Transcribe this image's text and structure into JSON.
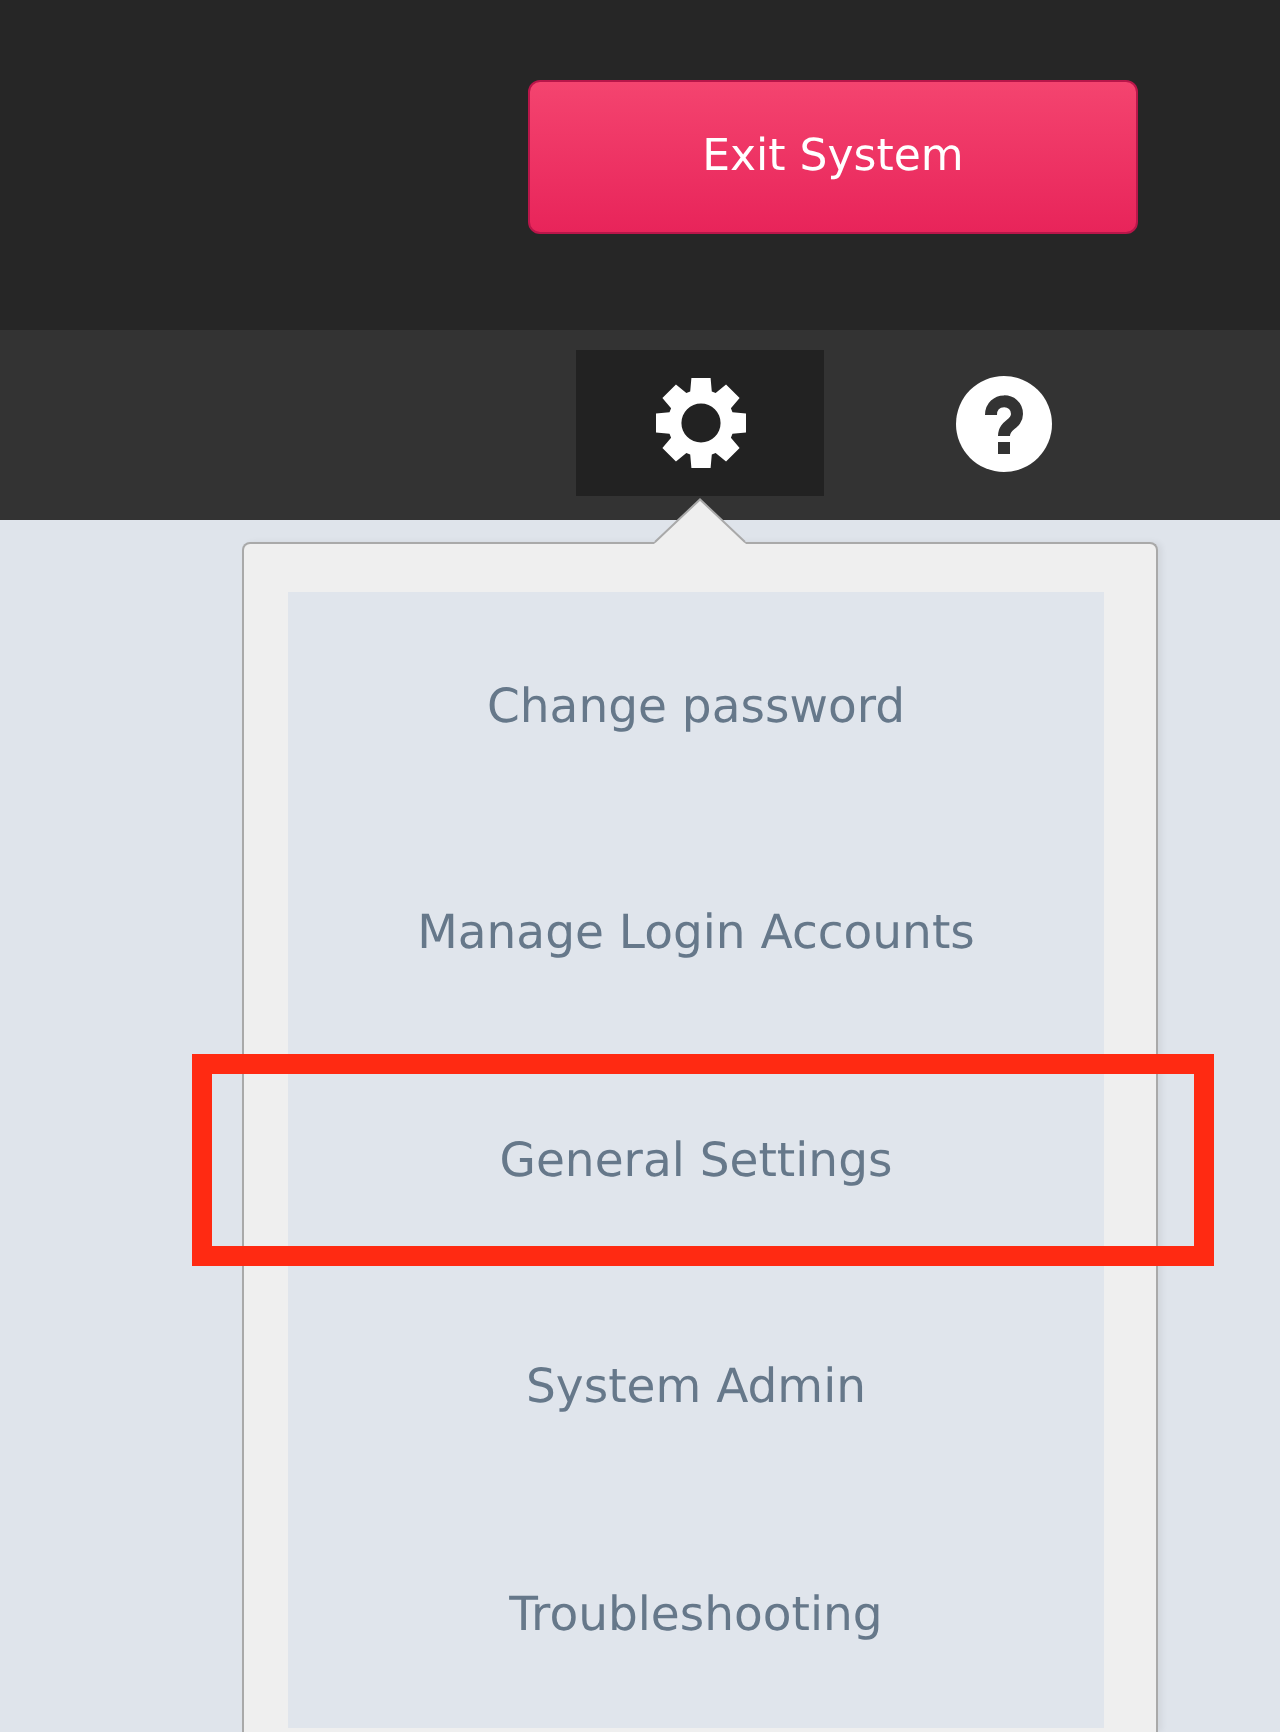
{
  "header": {
    "exit_button": {
      "label": "Exit System"
    }
  },
  "toolbar": {
    "buttons": [
      {
        "kind": "settings",
        "selected": true
      },
      {
        "kind": "help",
        "selected": false
      }
    ]
  },
  "menu": {
    "items": [
      {
        "label": "Change password",
        "highlighted": false
      },
      {
        "label": "Manage Login Accounts",
        "highlighted": false
      },
      {
        "label": "General Settings",
        "highlighted": true
      },
      {
        "label": "System Admin",
        "highlighted": false
      },
      {
        "label": "Troubleshooting",
        "highlighted": false
      }
    ]
  }
}
